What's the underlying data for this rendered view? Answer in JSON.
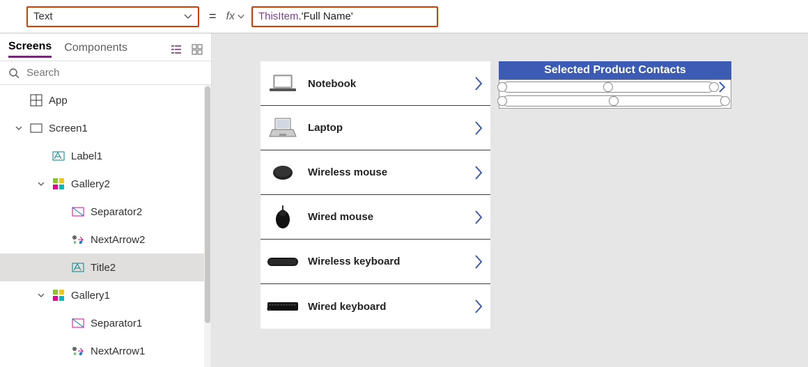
{
  "formula": {
    "property": "Text",
    "equals": "=",
    "fx": "fx",
    "obj": "ThisItem",
    "rest": ".'Full Name'"
  },
  "tabs": {
    "screens": "Screens",
    "components": "Components"
  },
  "search": {
    "placeholder": "Search"
  },
  "tree": {
    "app": "App",
    "screen1": "Screen1",
    "label1": "Label1",
    "gallery2": "Gallery2",
    "separator2": "Separator2",
    "nextarrow2": "NextArrow2",
    "title2": "Title2",
    "gallery1": "Gallery1",
    "separator1": "Separator1",
    "nextarrow1": "NextArrow1"
  },
  "gallery": {
    "items": [
      {
        "title": "Notebook"
      },
      {
        "title": "Laptop"
      },
      {
        "title": "Wireless mouse"
      },
      {
        "title": "Wired mouse"
      },
      {
        "title": "Wireless keyboard"
      },
      {
        "title": "Wired keyboard"
      }
    ]
  },
  "rightHeader": "Selected Product Contacts"
}
